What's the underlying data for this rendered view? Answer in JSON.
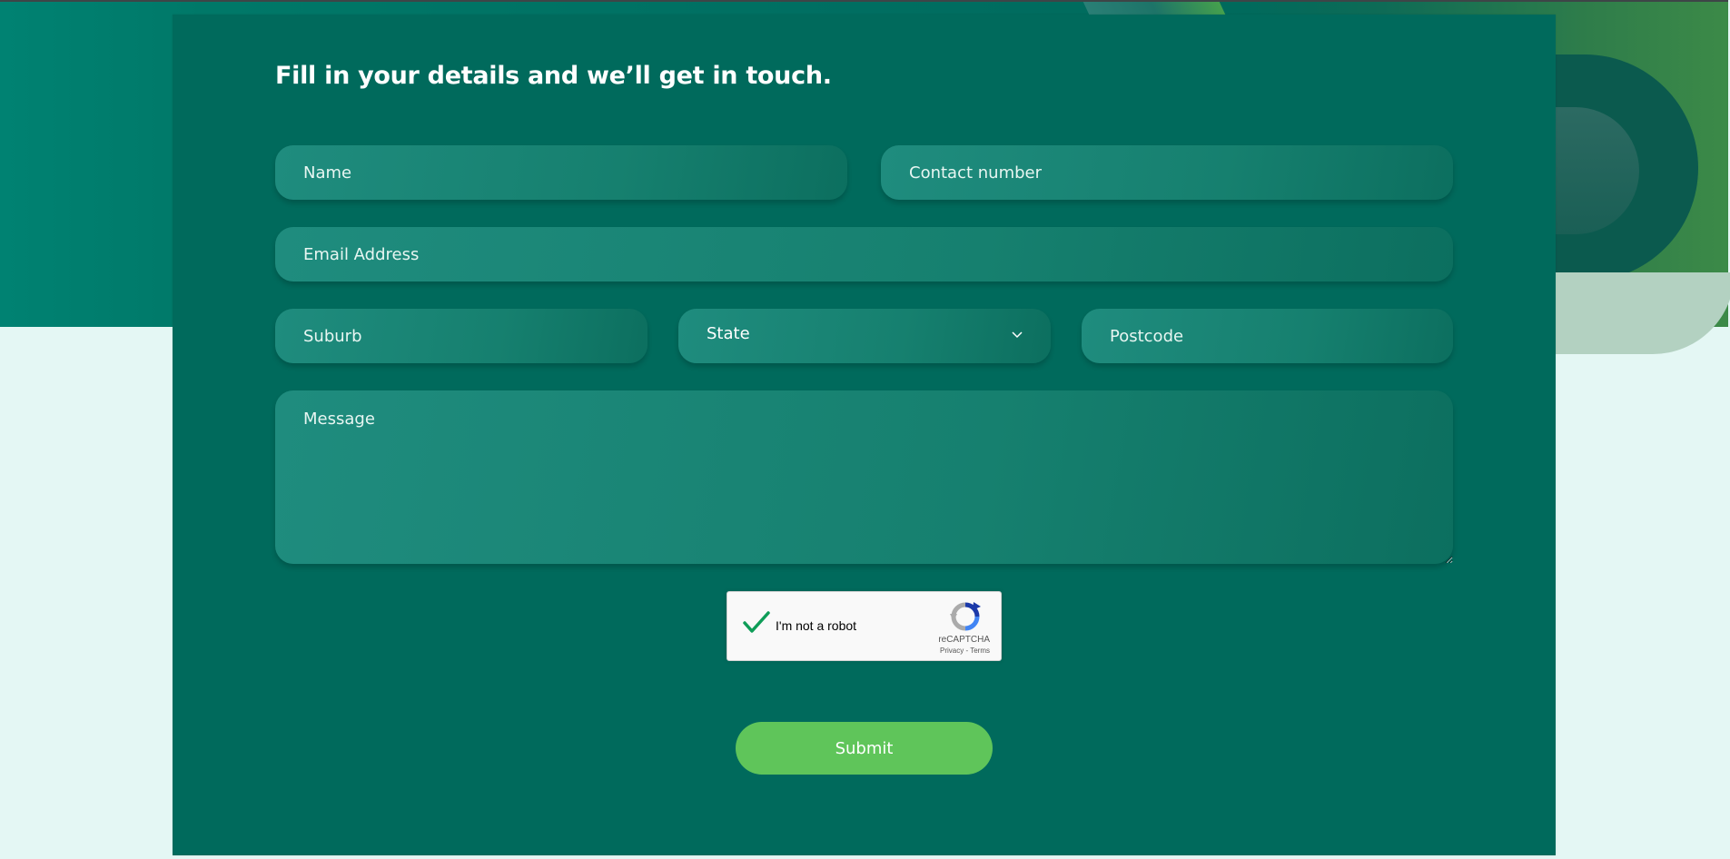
{
  "form": {
    "title": "Fill in your details and we’ll get in touch.",
    "name_placeholder": "Name",
    "contact_placeholder": "Contact number",
    "email_placeholder": "Email Address",
    "suburb_placeholder": "Suburb",
    "state_label": "State",
    "postcode_placeholder": "Postcode",
    "message_placeholder": "Message",
    "submit_label": "Submit"
  },
  "captcha": {
    "label": "I'm not a robot",
    "brand": "reCAPTCHA",
    "links": "Privacy - Terms",
    "checked": true,
    "check_color": "#0f9d58"
  },
  "icons": {
    "state_dropdown": "chevron-down-icon",
    "captcha_check": "check-icon",
    "captcha_logo": "recaptcha-icon"
  },
  "colors": {
    "card_background": "#006a5c",
    "field_background": "#1a8475",
    "submit_button": "#5fc55a",
    "page_background": "#e4f7f4"
  }
}
